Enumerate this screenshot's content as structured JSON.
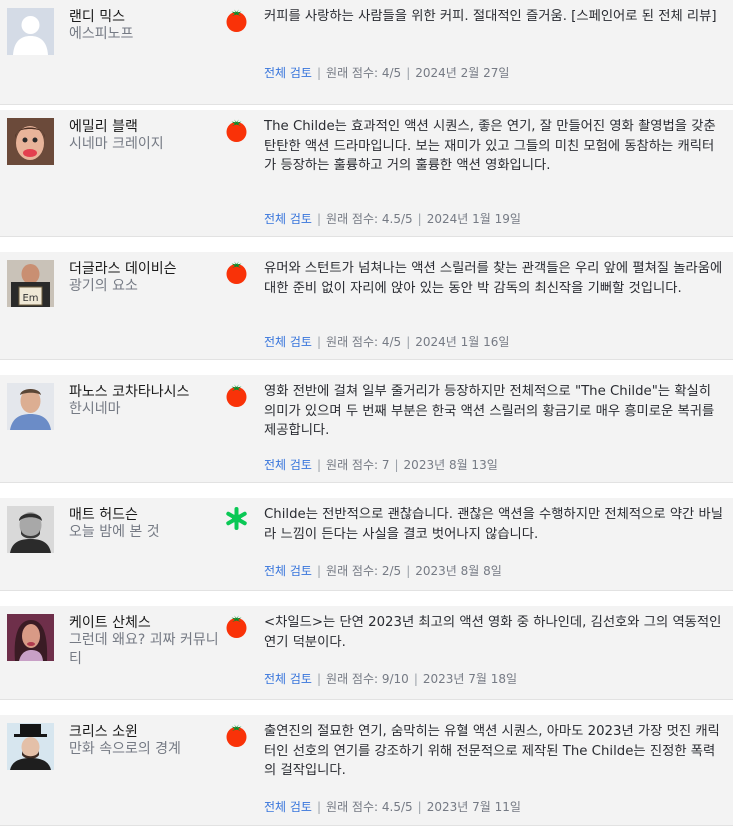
{
  "reviews": [
    {
      "name": "랜디 믹스",
      "publication": "에스피노프",
      "score_icon": "fresh-tomato-icon",
      "quote": "커피를 사랑하는 사람들을 위한 커피. 절대적인 즐거움. [스페인어로 된 전체 리뷰]",
      "link": "전체 검토",
      "original_score": "원래 점수: 4/5",
      "date": "2024년 2월 27일"
    },
    {
      "name": "에밀리 블랙",
      "publication": "시네마 크레이지",
      "score_icon": "fresh-tomato-icon",
      "quote": "The Childe는 효과적인 액션 시퀀스, 좋은 연기, 잘 만들어진 영화 촬영법을 갖춘 탄탄한 액션 드라마입니다. 보는 재미가 있고 그들의 미친 모험에 동참하는 캐릭터가 등장하는 훌륭하고 거의 훌륭한 액션 영화입니다.",
      "link": "전체 검토",
      "original_score": "원래 점수: 4.5/5",
      "date": "2024년 1월 19일"
    },
    {
      "name": "더글라스 데이비슨",
      "publication": "광기의 요소",
      "score_icon": "fresh-tomato-icon",
      "quote": "유머와 스턴트가 넘쳐나는 액션 스릴러를 찾는 관객들은 우리 앞에 펼쳐질 놀라움에 대한 준비 없이 자리에 앉아 있는 동안 박 감독의 최신작을 기뻐할 것입니다.",
      "link": "전체 검토",
      "original_score": "원래 점수: 4/5",
      "date": "2024년 1월 16일"
    },
    {
      "name": "파노스 코차타나시스",
      "publication": "한시네마",
      "score_icon": "fresh-tomato-icon",
      "quote": "영화 전반에 걸쳐 일부 줄거리가 등장하지만 전체적으로 \"The Childe\"는 확실히 의미가 있으며 두 번째 부분은 한국 액션 스릴러의 황금기로 매우 흥미로운 복귀를 제공합니다.",
      "link": "전체 검토",
      "original_score": "원래 점수: 7",
      "date": "2023년 8월 13일"
    },
    {
      "name": "매트 허드슨",
      "publication": "오늘 밤에 본 것",
      "score_icon": "rotten-splat-icon",
      "quote": "Childe는 전반적으로 괜찮습니다. 괜찮은 액션을 수행하지만 전체적으로 약간 바닐라 느낌이 든다는 사실을 결코 벗어나지 않습니다.",
      "link": "전체 검토",
      "original_score": "원래 점수: 2/5",
      "date": "2023년 8월 8일"
    },
    {
      "name": "케이트 산체스",
      "publication": "그런데 왜요? 괴짜 커뮤니티",
      "score_icon": "fresh-tomato-icon",
      "quote": "<차일드>는 단연 2023년 최고의 액션 영화 중 하나인데, 김선호와 그의 역동적인 연기 덕분이다.",
      "link": "전체 검토",
      "original_score": "원래 점수: 9/10",
      "date": "2023년 7월 18일"
    },
    {
      "name": "크리스 소윈",
      "publication": "만화 속으로의 경계",
      "score_icon": "fresh-tomato-icon",
      "quote": "출연진의 절묘한 연기, 숨막히는 유혈 액션 시퀀스, 아마도 2023년 가장 멋진 캐릭터인 선호의 연기를 강조하기 위해 전문적으로 제작된 The Childe는 진정한 폭력의 걸작입니다.",
      "link": "전체 검토",
      "original_score": "원래 점수: 4.5/5",
      "date": "2023년 7월 11일"
    }
  ]
}
